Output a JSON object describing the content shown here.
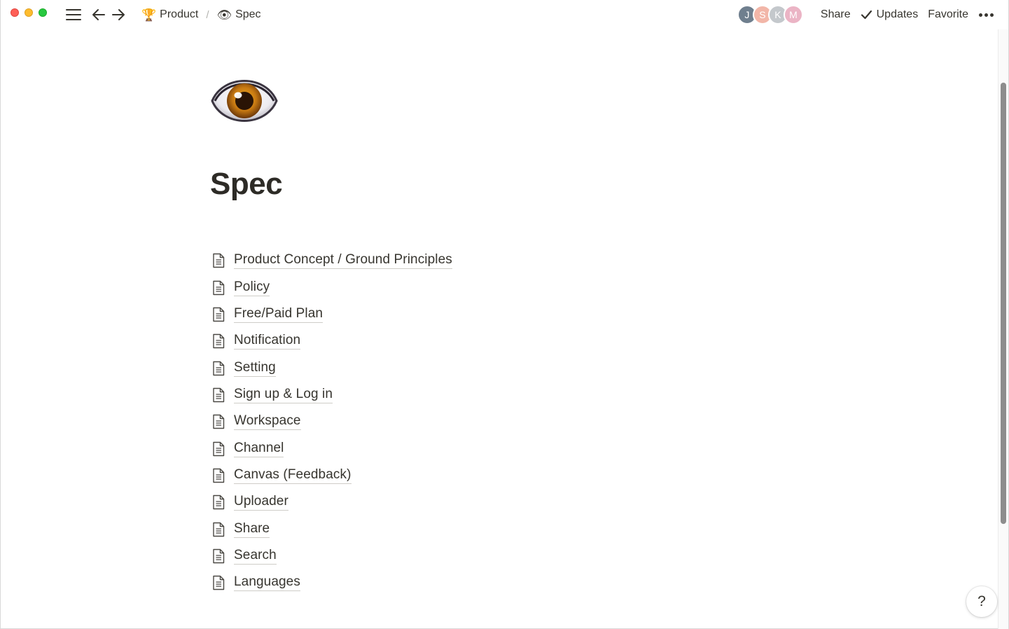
{
  "window": {
    "traffic_lights": [
      "close",
      "minimize",
      "zoom"
    ]
  },
  "topbar": {
    "breadcrumb": [
      {
        "icon": "trophy-icon",
        "emoji": "🏆",
        "label": "Product"
      },
      {
        "icon": "eye-icon",
        "emoji": "👁",
        "label": "Spec"
      }
    ],
    "separator": "/",
    "avatars": [
      {
        "initial": "J",
        "color": "#6f7f8e"
      },
      {
        "initial": "S",
        "color": "#f2b6a8"
      },
      {
        "initial": "K",
        "color": "#c4c8cc"
      },
      {
        "initial": "M",
        "color": "#ebb4c5"
      }
    ],
    "share_label": "Share",
    "updates_label": "Updates",
    "favorite_label": "Favorite"
  },
  "page": {
    "icon": "eye-icon",
    "title": "Spec",
    "subpages": [
      "Product Concept / Ground Principles",
      "Policy",
      "Free/Paid Plan",
      "Notification",
      "Setting",
      "Sign up & Log in",
      "Workspace",
      "Channel",
      "Canvas (Feedback)",
      "Uploader",
      "Share",
      "Search",
      "Languages"
    ]
  },
  "help": {
    "label": "?"
  }
}
